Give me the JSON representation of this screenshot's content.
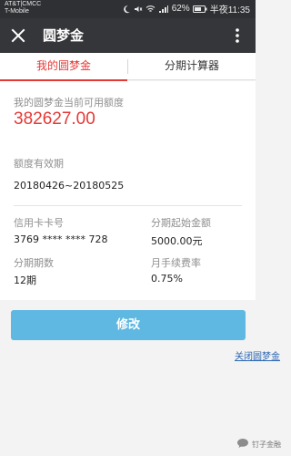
{
  "status_bar": {
    "carrier_line1": "AT&T|CMCC",
    "carrier_line2": "T-Mobile",
    "battery_text": "62%",
    "time": "半夜11:35"
  },
  "header": {
    "title": "圆梦金"
  },
  "tabs": [
    {
      "label": "我的圆梦金",
      "active": true
    },
    {
      "label": "分期计算器",
      "active": false
    }
  ],
  "credit": {
    "available_label": "我的圆梦金当前可用额度",
    "available_amount": "382627.00",
    "validity_label": "额度有效期",
    "validity_value": "20180426~20180525",
    "card_label": "信用卡卡号",
    "card_value": "3769 **** **** 728",
    "start_amount_label": "分期起始金额",
    "start_amount_value": "5000.00元",
    "periods_label": "分期期数",
    "periods_value": "12期",
    "fee_label": "月手续费率",
    "fee_value": "0.75%"
  },
  "actions": {
    "modify": "修改",
    "close_link": "关闭圆梦金"
  },
  "watermark": {
    "text": "钉子金融"
  },
  "colors": {
    "accent_red": "#e53935",
    "button_blue": "#5eb8e1",
    "link_blue": "#2b67b4",
    "header_dark": "#35363a"
  }
}
